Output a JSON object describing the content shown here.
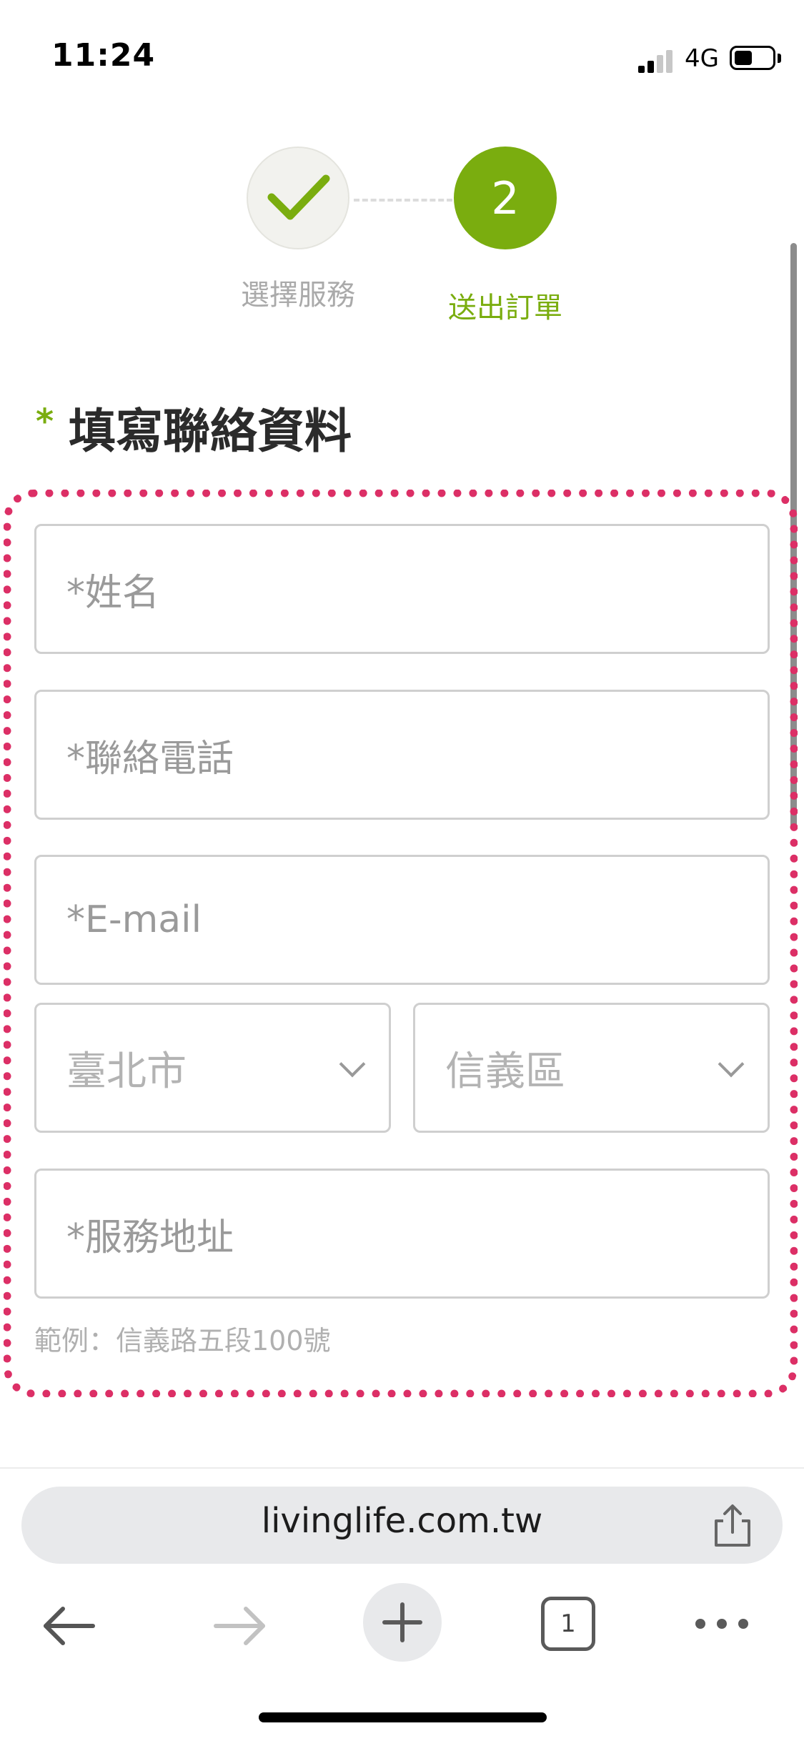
{
  "status_bar": {
    "time": "11:24",
    "network": "4G"
  },
  "stepper": {
    "steps": [
      {
        "label": "選擇服務",
        "state": "done"
      },
      {
        "label": "送出訂單",
        "number": "2",
        "state": "active"
      }
    ]
  },
  "section": {
    "required_mark": "*",
    "title": "填寫聯絡資料"
  },
  "form": {
    "name_placeholder": "*姓名",
    "phone_placeholder": "*聯絡電話",
    "email_placeholder": "*E-mail",
    "city_value": "臺北市",
    "district_value": "信義區",
    "address_placeholder": "*服務地址",
    "address_hint": "範例：信義路五段100號"
  },
  "browser": {
    "url": "livinglife.com.tw",
    "tab_count": "1"
  },
  "colors": {
    "accent_green": "#7aad0f",
    "highlight_pink": "#dc2f66"
  },
  "icons": [
    "checkmark-icon",
    "chevron-down-icon",
    "share-icon",
    "back-arrow-icon",
    "forward-arrow-icon",
    "plus-icon",
    "tabs-icon",
    "more-icon"
  ]
}
